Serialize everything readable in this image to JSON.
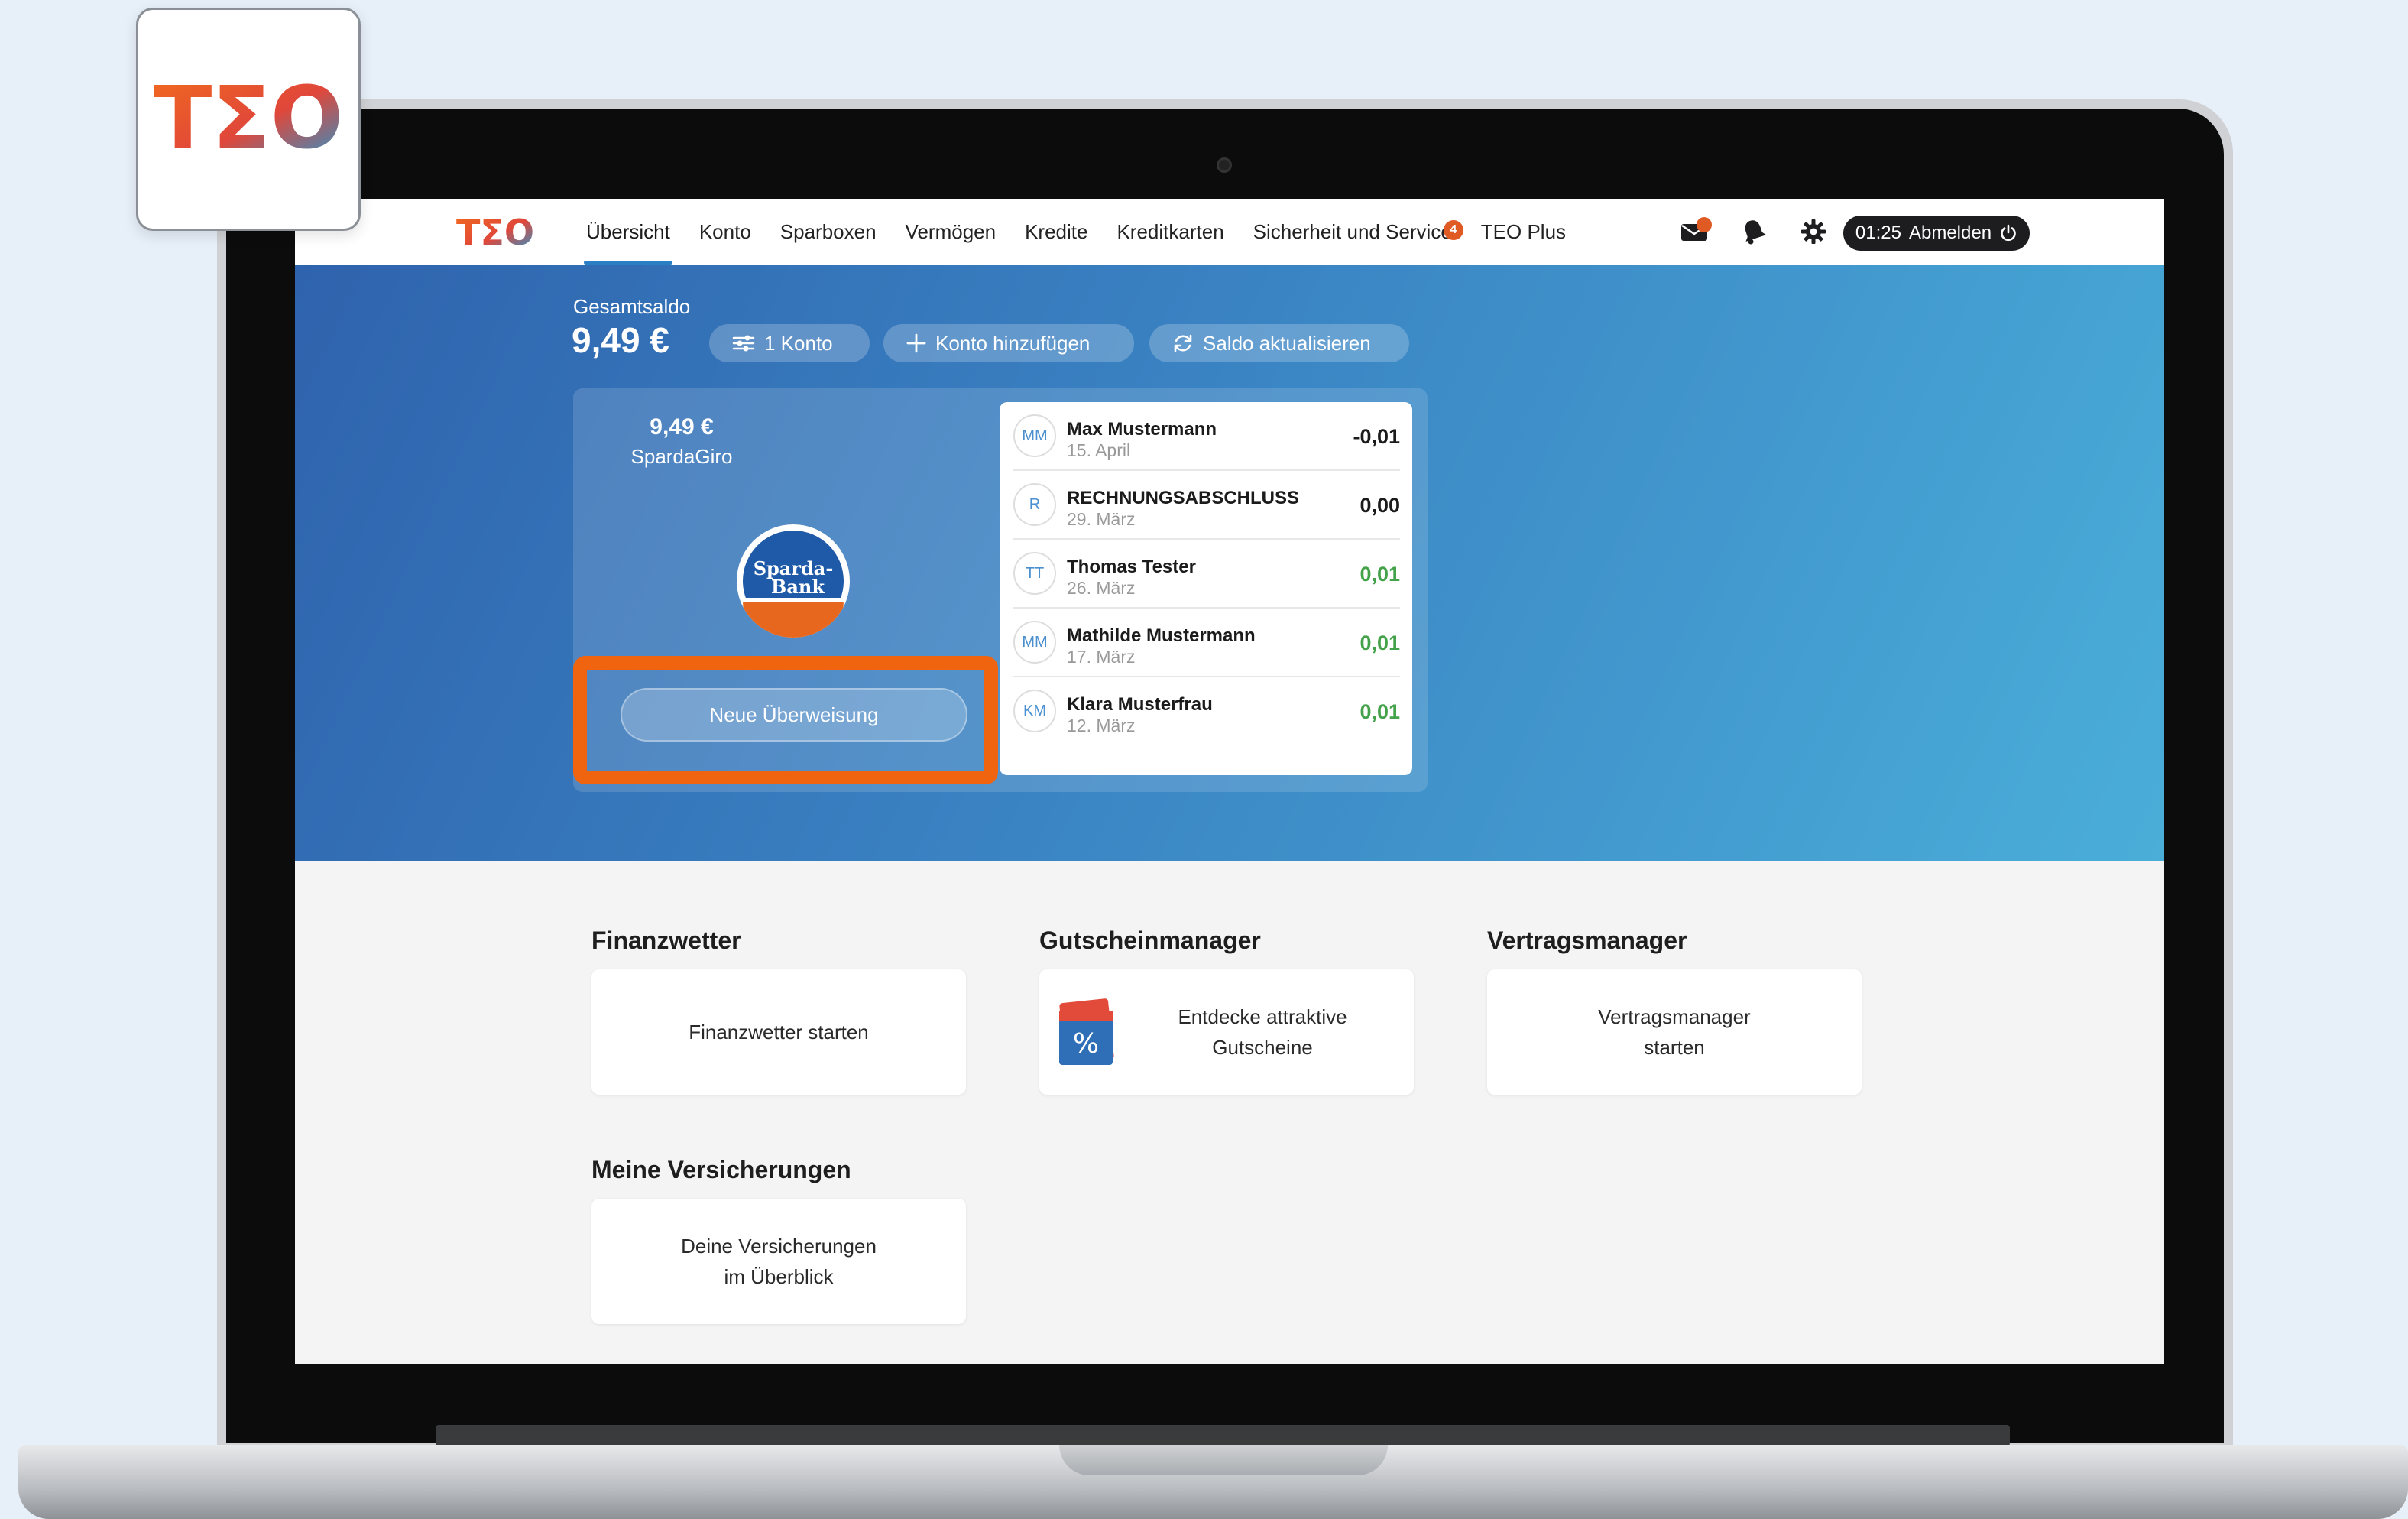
{
  "app_tile": {
    "logo_text": "TΣO"
  },
  "nav": {
    "logo_text": "TΣO",
    "items": [
      {
        "label": "Übersicht",
        "active": true
      },
      {
        "label": "Konto"
      },
      {
        "label": "Sparboxen"
      },
      {
        "label": "Vermögen"
      },
      {
        "label": "Kredite"
      },
      {
        "label": "Kreditkarten"
      },
      {
        "label": "Sicherheit und Service",
        "badge": "4"
      },
      {
        "label": "TEO Plus"
      }
    ],
    "timer": "01:25",
    "logout_label": "Abmelden",
    "icons": [
      "mail-icon",
      "bell-icon",
      "gear-icon",
      "power-icon"
    ]
  },
  "overview": {
    "total_label": "Gesamtsaldo",
    "total_value": "9,49 €",
    "accounts_pill": "1 Konto",
    "add_account_pill": "Konto hinzufügen",
    "refresh_pill": "Saldo aktualisieren"
  },
  "account": {
    "amount": "9,49 €",
    "name": "SpardaGiro",
    "bank_logo_text": [
      "Sparda-",
      "Bank"
    ],
    "transfer_button": "Neue Überweisung"
  },
  "transactions": [
    {
      "initials": "MM",
      "name": "Max Mustermann",
      "date": "15. April",
      "amount": "-0,01",
      "type": "neg"
    },
    {
      "initials": "R",
      "name": "RECHNUNGSABSCHLUSS",
      "date": "29. März",
      "amount": "0,00",
      "type": "zero"
    },
    {
      "initials": "TT",
      "name": "Thomas Tester",
      "date": "26. März",
      "amount": "0,01",
      "type": "pos"
    },
    {
      "initials": "MM",
      "name": "Mathilde Mustermann",
      "date": "17. März",
      "amount": "0,01",
      "type": "pos"
    },
    {
      "initials": "KM",
      "name": "Klara Musterfrau",
      "date": "12. März",
      "amount": "0,01",
      "type": "pos"
    }
  ],
  "sections": {
    "finanzwetter": {
      "title": "Finanzwetter",
      "card": "Finanzwetter starten"
    },
    "gutschein": {
      "title": "Gutscheinmanager",
      "card_line1": "Entdecke attraktive",
      "card_line2": "Gutscheine"
    },
    "vertrag": {
      "title": "Vertragsmanager",
      "card_line1": "Vertragsmanager",
      "card_line2": "starten"
    },
    "versicherungen": {
      "title": "Meine Versicherungen",
      "card_line1": "Deine Versicherungen",
      "card_line2": "im Überblick"
    }
  },
  "colors": {
    "accent": "#2a7ec3",
    "orange": "#f06410",
    "positive": "#44a24a"
  }
}
